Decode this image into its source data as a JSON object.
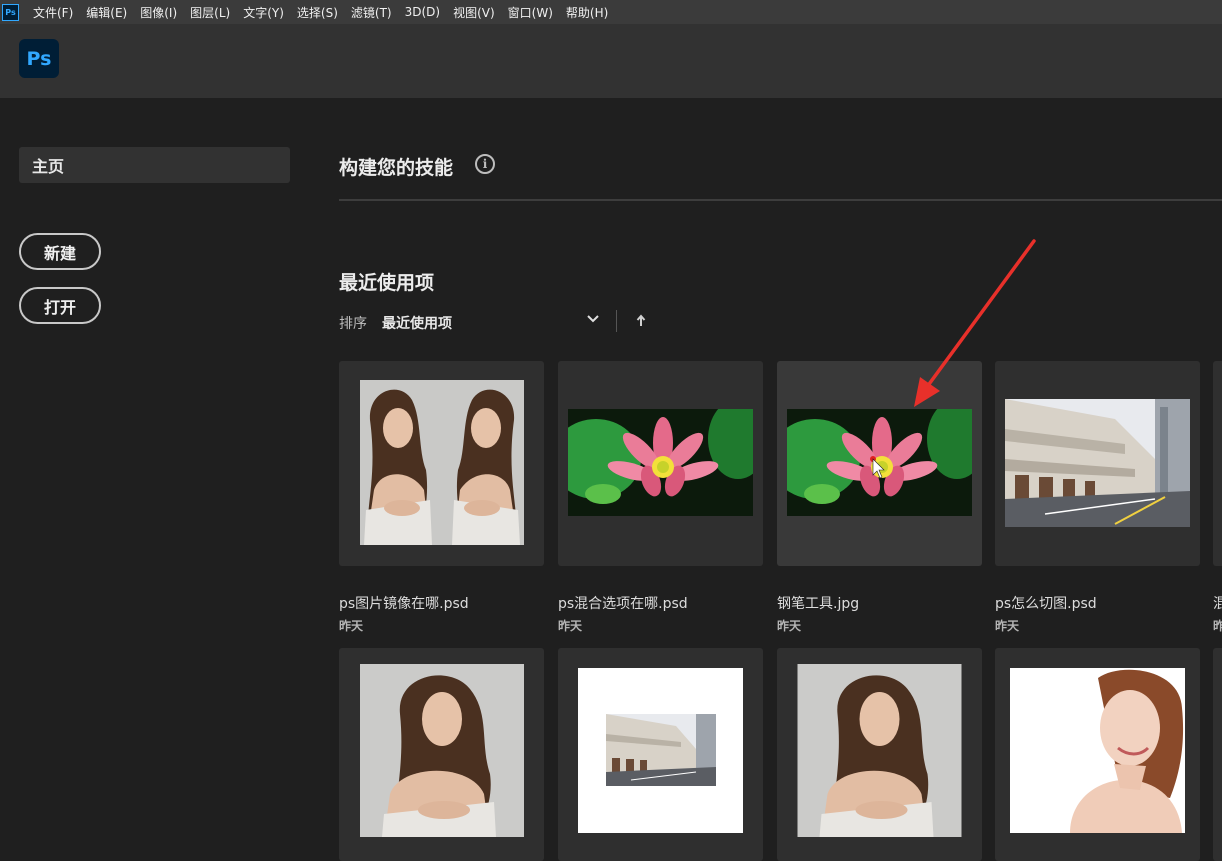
{
  "menubar": {
    "items": [
      "文件(F)",
      "编辑(E)",
      "图像(I)",
      "图层(L)",
      "文字(Y)",
      "选择(S)",
      "滤镜(T)",
      "3D(D)",
      "视图(V)",
      "窗口(W)",
      "帮助(H)"
    ]
  },
  "app": {
    "icon_text": "Ps",
    "logo_text": "Ps",
    "accent": "#31a8ff"
  },
  "sidebar": {
    "home": "主页",
    "new_button": "新建",
    "open_button": "打开"
  },
  "main": {
    "skills_title": "构建您的技能",
    "info_icon": "i",
    "recent_title": "最近使用项",
    "sort_label": "排序",
    "sort_value": "最近使用项"
  },
  "files": [
    {
      "name": "ps图片镜像在哪.psd",
      "date": "昨天",
      "thumb": "mirror-portrait"
    },
    {
      "name": "ps混合选项在哪.psd",
      "date": "昨天",
      "thumb": "lotus"
    },
    {
      "name": "钢笔工具.jpg",
      "date": "昨天",
      "thumb": "lotus"
    },
    {
      "name": "ps怎么切图.psd",
      "date": "昨天",
      "thumb": "street"
    }
  ],
  "files_row2": [
    {
      "thumb": "portrait"
    },
    {
      "thumb": "street-small"
    },
    {
      "thumb": "portrait"
    },
    {
      "thumb": "woman-white"
    }
  ],
  "edge": {
    "name": "混",
    "date": "昨"
  }
}
